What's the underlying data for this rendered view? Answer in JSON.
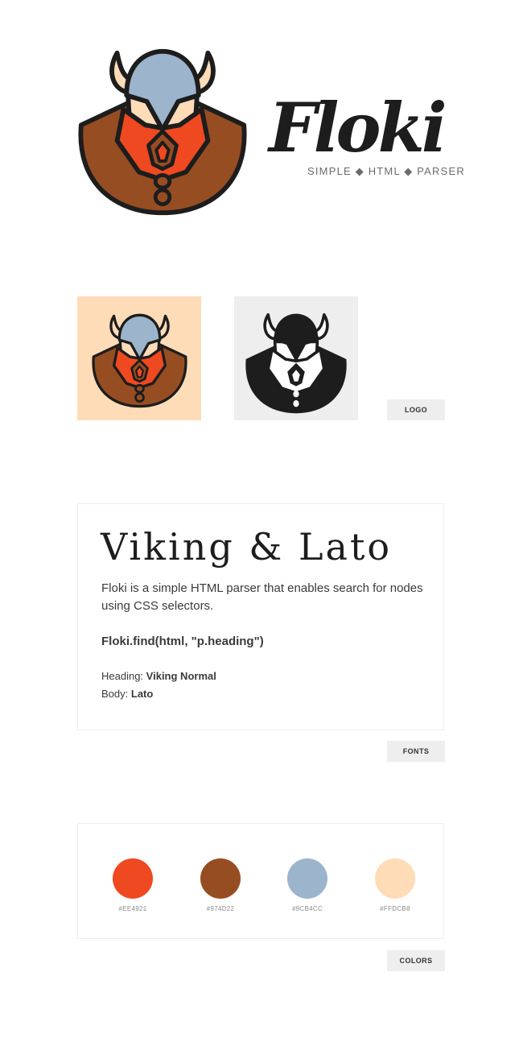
{
  "brand": {
    "name": "Floki",
    "tagline": "SIMPLE ◆ HTML ◆ PARSER"
  },
  "sections": {
    "logo_label": "LOGO",
    "fonts_label": "FONTS",
    "colors_label": "COLORS"
  },
  "fonts": {
    "heading": "Viking & Lato",
    "description": "Floki is a simple HTML parser that enables search for nodes using CSS selectors.",
    "code": "Floki.find(html, \"p.heading\")",
    "heading_prefix": "Heading:",
    "heading_font": "Viking Normal",
    "body_prefix": "Body:",
    "body_font": "Lato"
  },
  "palette": [
    {
      "hex": "#EE4921",
      "label": "#EE4921"
    },
    {
      "hex": "#974D22",
      "label": "#974D22"
    },
    {
      "hex": "#9CB4CC",
      "label": "#9CB4CC"
    },
    {
      "hex": "#FFDCB8",
      "label": "#FFDCB8"
    }
  ],
  "icons": {
    "mascot": "viking-mascot-icon"
  }
}
